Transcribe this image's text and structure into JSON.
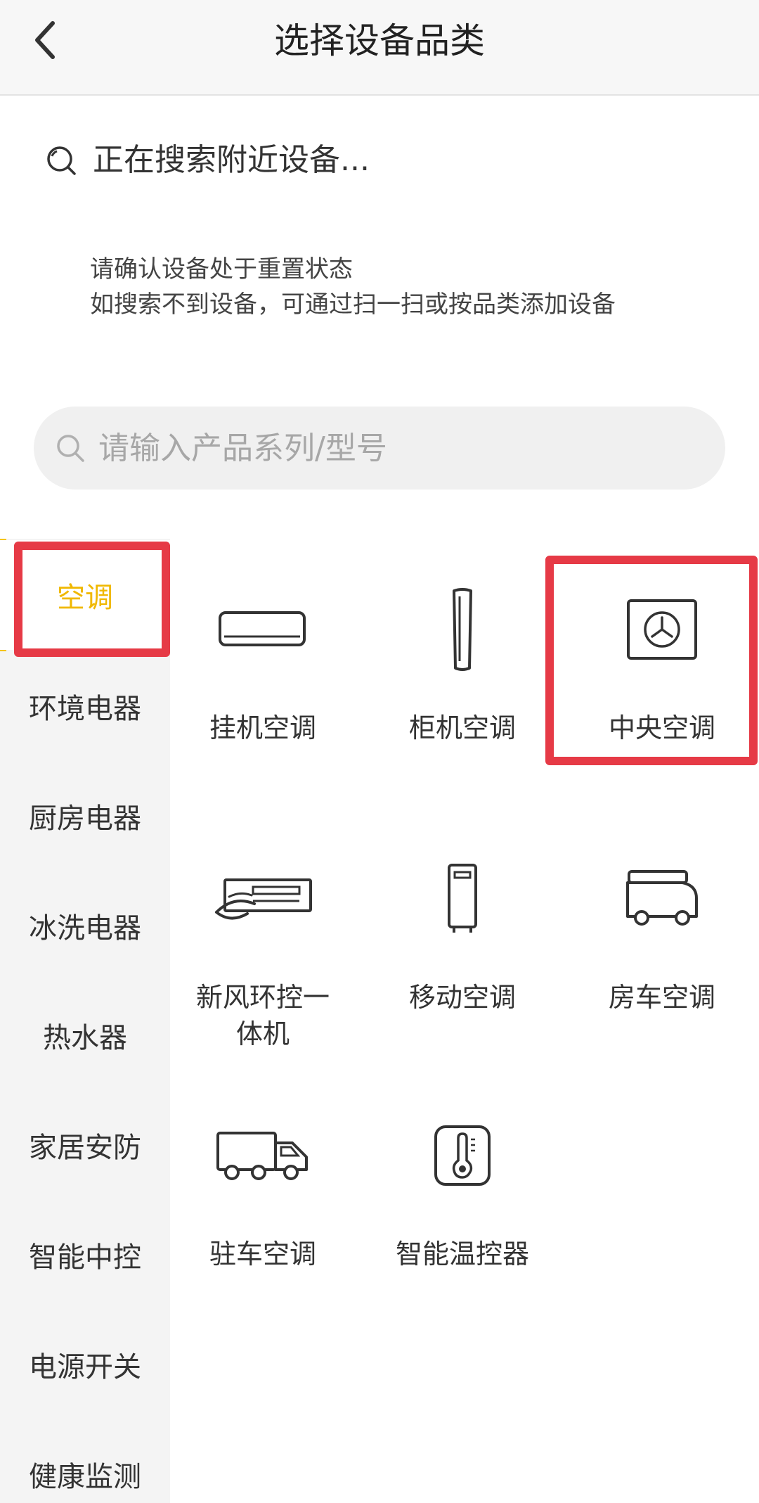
{
  "header": {
    "title": "选择设备品类",
    "back_icon": "chevron-left-icon"
  },
  "scan": {
    "status_text": "正在搜索附近设备...",
    "icon": "search-icon"
  },
  "hint": {
    "line1": "请确认设备处于重置状态",
    "line2": "如搜索不到设备，可通过扫一扫或按品类添加设备"
  },
  "search": {
    "placeholder": "请输入产品系列/型号",
    "value": ""
  },
  "colors": {
    "accent": "#f5c400",
    "accent_text": "#f0b800",
    "highlight": "#e63a46"
  },
  "sidebar": {
    "items": [
      {
        "label": "空调",
        "active": true
      },
      {
        "label": "环境电器"
      },
      {
        "label": "厨房电器"
      },
      {
        "label": "冰洗电器"
      },
      {
        "label": "热水器"
      },
      {
        "label": "家居安防"
      },
      {
        "label": "智能中控"
      },
      {
        "label": "电源开关"
      },
      {
        "label": "健康监测"
      }
    ]
  },
  "products": [
    {
      "label": "挂机空调",
      "icon": "wall-ac-icon"
    },
    {
      "label": "柜机空调",
      "icon": "floor-ac-icon"
    },
    {
      "label": "中央空调",
      "icon": "central-ac-icon"
    },
    {
      "label": "新风环控一体机",
      "label_line1": "新风环控一",
      "label_line2": "体机",
      "icon": "fresh-air-icon"
    },
    {
      "label": "移动空调",
      "icon": "portable-ac-icon"
    },
    {
      "label": "房车空调",
      "icon": "rv-ac-icon"
    },
    {
      "label": "驻车空调",
      "icon": "truck-ac-icon"
    },
    {
      "label": "智能温控器",
      "icon": "thermostat-icon"
    }
  ]
}
